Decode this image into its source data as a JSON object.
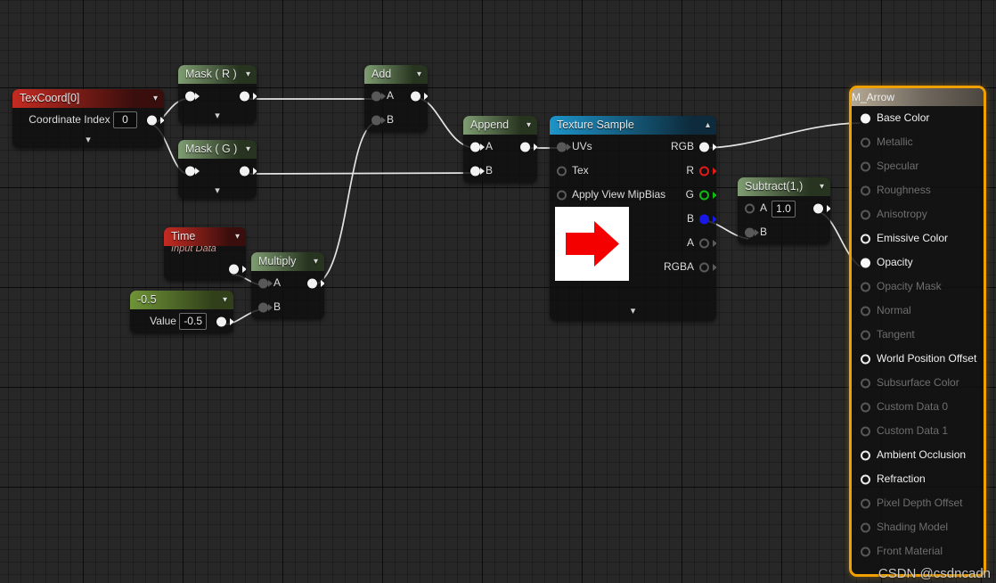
{
  "editor": {
    "name": "unreal-material-graph",
    "watermark": "CSDN @csdncadn",
    "accent_selected": "#f0a000",
    "canvas_bg": "#272727"
  },
  "nodes": {
    "texcoord": {
      "title": "TexCoord[0]",
      "header_color": "#c42b22",
      "prop_label": "Coordinate Index",
      "prop_value": "0",
      "chevron": "chevron-down",
      "bottom_chevron": "chevron-down"
    },
    "mask_r": {
      "title": "Mask ( R )",
      "header_color": "#7f9d72",
      "chevron": "chevron-down",
      "bottom_chevron": "chevron-down"
    },
    "mask_g": {
      "title": "Mask ( G )",
      "header_color": "#7f9d72",
      "chevron": "chevron-down",
      "bottom_chevron": "chevron-down"
    },
    "add": {
      "title": "Add",
      "header_color": "#7f9d72",
      "chevron": "chevron-down",
      "input_a": "A",
      "input_b": "B"
    },
    "append": {
      "title": "Append",
      "header_color": "#7f9d72",
      "chevron": "chevron-down",
      "input_a": "A",
      "input_b": "B"
    },
    "time": {
      "title": "Time",
      "subtitle": "Input Data",
      "header_color": "#c42b22",
      "chevron": "chevron-down"
    },
    "constant": {
      "title": "-0.5",
      "header_color": "#6f9437",
      "chevron": "chevron-down",
      "prop_label": "Value",
      "prop_value": "-0.5"
    },
    "multiply": {
      "title": "Multiply",
      "header_color": "#7f9d72",
      "chevron": "chevron-down",
      "input_a": "A",
      "input_b": "B"
    },
    "texture_sample": {
      "title": "Texture Sample",
      "header_color": "#1d94c9",
      "chevron": "chevron-up",
      "inputs": [
        "UVs",
        "Tex",
        "Apply View MipBias"
      ],
      "outputs": [
        "RGB",
        "R",
        "G",
        "B",
        "A",
        "RGBA"
      ],
      "thumbnail": "red-right-arrow-texture",
      "bottom_chevron": "chevron-down"
    },
    "subtract": {
      "title": "Subtract(1,)",
      "header_color": "#7f9d72",
      "chevron": "chevron-down",
      "input_a": "A",
      "input_a_value": "1.0",
      "input_b": "B"
    }
  },
  "output_node": {
    "title": "M_Arrow",
    "border_color": "#f0a000",
    "pins": [
      {
        "label": "Base Color",
        "state": "connected"
      },
      {
        "label": "Metallic",
        "state": "disabled"
      },
      {
        "label": "Specular",
        "state": "disabled"
      },
      {
        "label": "Roughness",
        "state": "disabled"
      },
      {
        "label": "Anisotropy",
        "state": "disabled"
      },
      {
        "label": "Emissive Color",
        "state": "enabled"
      },
      {
        "label": "Opacity",
        "state": "connected"
      },
      {
        "label": "Opacity Mask",
        "state": "disabled"
      },
      {
        "label": "Normal",
        "state": "disabled"
      },
      {
        "label": "Tangent",
        "state": "disabled"
      },
      {
        "label": "World Position Offset",
        "state": "enabled"
      },
      {
        "label": "Subsurface Color",
        "state": "disabled"
      },
      {
        "label": "Custom Data 0",
        "state": "disabled"
      },
      {
        "label": "Custom Data 1",
        "state": "disabled"
      },
      {
        "label": "Ambient Occlusion",
        "state": "enabled"
      },
      {
        "label": "Refraction",
        "state": "enabled"
      },
      {
        "label": "Pixel Depth Offset",
        "state": "disabled"
      },
      {
        "label": "Shading Model",
        "state": "disabled"
      },
      {
        "label": "Front Material",
        "state": "disabled"
      }
    ]
  }
}
